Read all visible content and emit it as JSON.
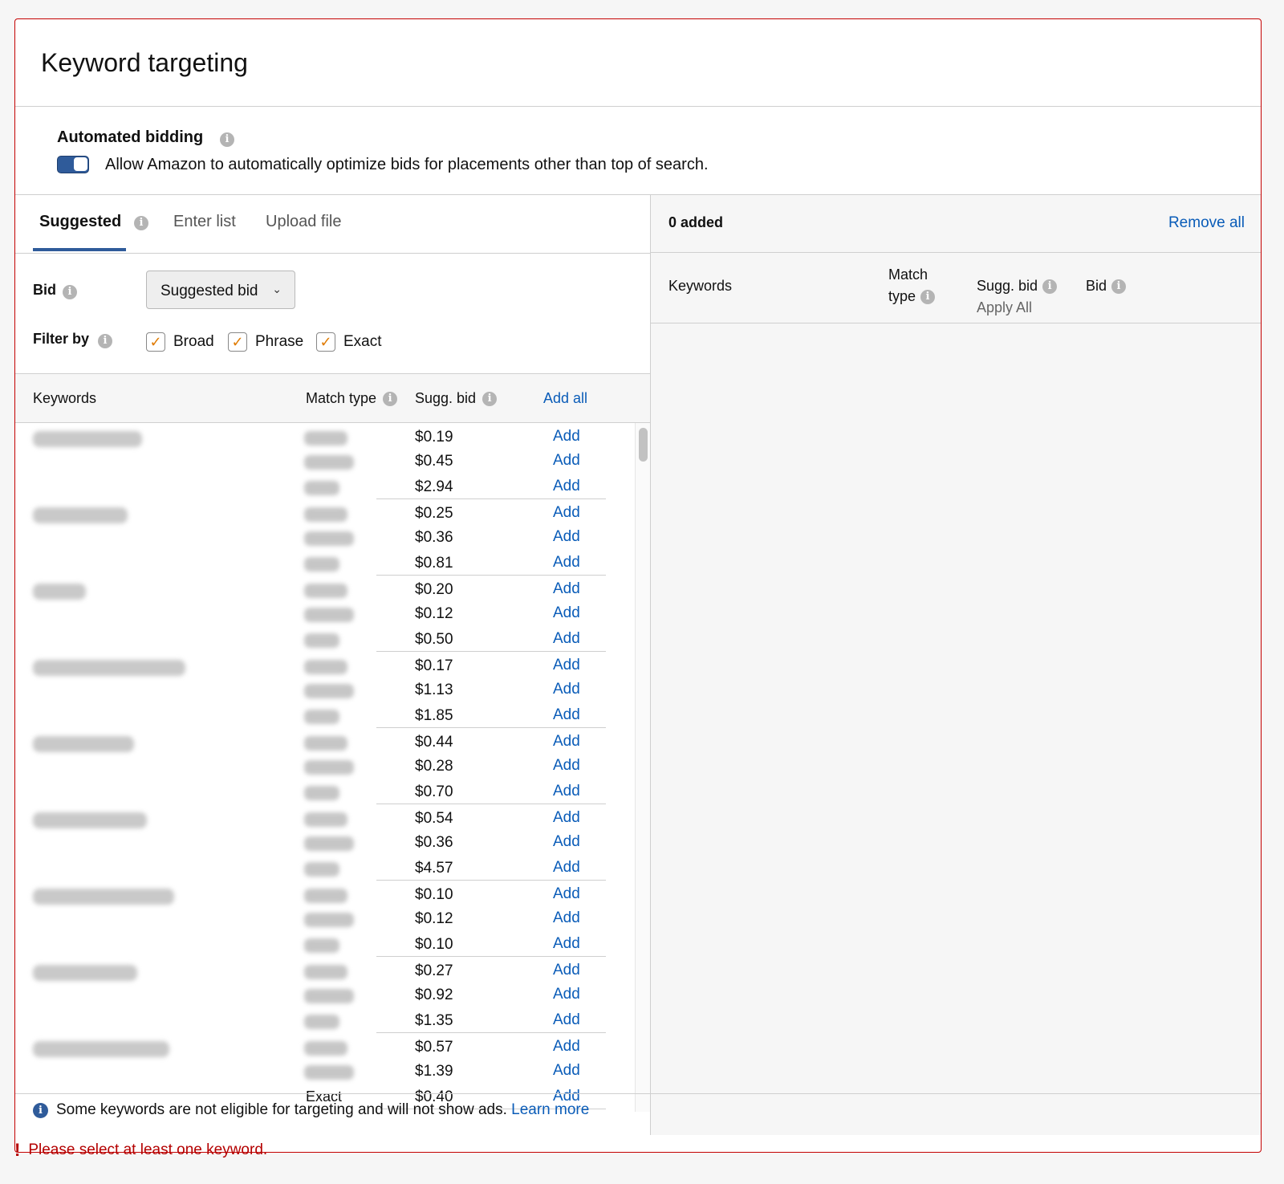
{
  "title": "Keyword targeting",
  "automated_bidding": {
    "title": "Automated bidding",
    "description": "Allow Amazon to automatically optimize bids for placements other than top of search.",
    "enabled": true
  },
  "tabs": {
    "suggested": "Suggested",
    "enter_list": "Enter list",
    "upload_file": "Upload file"
  },
  "bid": {
    "label": "Bid",
    "dropdown_value": "Suggested bid"
  },
  "filter": {
    "label": "Filter by",
    "options": [
      "Broad",
      "Phrase",
      "Exact"
    ]
  },
  "table": {
    "col_keywords": "Keywords",
    "col_match_type": "Match type",
    "col_sugg_bid": "Sugg. bid",
    "add_all": "Add all",
    "add_label": "Add",
    "partial_match_type": "Exact",
    "groups": [
      {
        "bids": [
          "$0.19",
          "$0.45",
          "$2.94"
        ]
      },
      {
        "bids": [
          "$0.25",
          "$0.36",
          "$0.81"
        ]
      },
      {
        "bids": [
          "$0.20",
          "$0.12",
          "$0.50"
        ]
      },
      {
        "bids": [
          "$0.17",
          "$1.13",
          "$1.85"
        ]
      },
      {
        "bids": [
          "$0.44",
          "$0.28",
          "$0.70"
        ]
      },
      {
        "bids": [
          "$0.54",
          "$0.36",
          "$4.57"
        ]
      },
      {
        "bids": [
          "$0.10",
          "$0.12",
          "$0.10"
        ]
      },
      {
        "bids": [
          "$0.27",
          "$0.92",
          "$1.35"
        ]
      },
      {
        "bids": [
          "$0.57",
          "$1.39",
          "$0.40"
        ]
      }
    ]
  },
  "added_panel": {
    "count_label": "0 added",
    "remove_all": "Remove all",
    "col_keywords": "Keywords",
    "col_match_line1": "Match",
    "col_match_line2": "type",
    "col_sugg_bid": "Sugg. bid",
    "apply_all": "Apply All",
    "col_bid": "Bid"
  },
  "footer": {
    "notice": "Some keywords are not eligible for targeting and will not show ads.",
    "learn_more": "Learn more"
  },
  "error": "Please select at least one keyword.",
  "colors": {
    "accent_blue": "#2f5b9a",
    "link": "#0a5cb8",
    "error_red": "#b40000",
    "checkbox_orange": "#e07b00"
  }
}
